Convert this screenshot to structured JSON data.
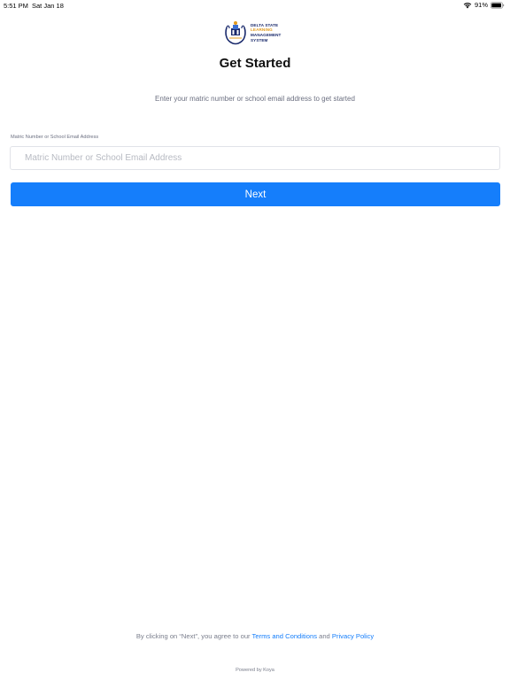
{
  "status_bar": {
    "time": "5:51 PM",
    "date": "Sat Jan 18",
    "battery": "91%",
    "icons": [
      "wifi-icon",
      "battery-icon"
    ]
  },
  "logo": {
    "lines": [
      "DELTA STATE",
      "LEARNING",
      "MANAGEMENT",
      "SYSTEM"
    ],
    "seal_text": "DSLMS",
    "colors": {
      "navy": "#1a2a6c",
      "orange": "#e39b1d"
    }
  },
  "header": {
    "title": "Get Started",
    "subtitle": "Enter your matric number or school email address to get started"
  },
  "form": {
    "label": "Matric Number or School Email Address",
    "input_value": "",
    "input_placeholder": "Matric Number or School Email Address",
    "submit_label": "Next"
  },
  "footer": {
    "terms_prefix": "By clicking on “Next”, you agree to our ",
    "terms_link": "Terms and Conditions",
    "terms_and": " and ",
    "privacy_link": "Privacy Policy",
    "powered_by": "Powered by Koya"
  },
  "colors": {
    "accent": "#157efb",
    "muted_text": "#6b6f80"
  }
}
